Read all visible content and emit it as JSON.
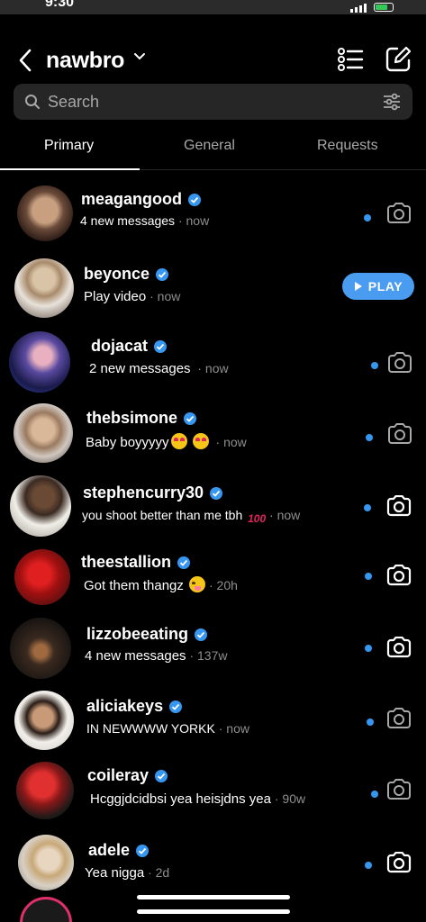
{
  "status_bar": {
    "time": "9:30"
  },
  "header": {
    "account_name": "nawbro"
  },
  "search": {
    "placeholder": "Search"
  },
  "tabs": [
    {
      "label": "Primary",
      "active": true
    },
    {
      "label": "General",
      "active": false
    },
    {
      "label": "Requests",
      "active": false
    }
  ],
  "threads": [
    {
      "username": "meagangood",
      "preview": "4 new messages",
      "time": "now",
      "unread": true,
      "action": "camera"
    },
    {
      "username": "beyonce",
      "preview": "Play video",
      "time": "now",
      "unread": false,
      "action": "play"
    },
    {
      "username": "dojacat",
      "preview": "2 new messages",
      "time": "now",
      "unread": true,
      "action": "camera"
    },
    {
      "username": "thebsimone",
      "preview": "Baby boyyyyy",
      "time": "now",
      "unread": true,
      "action": "camera"
    },
    {
      "username": "stephencurry30",
      "preview": "you shoot better than me tbh",
      "time": "now",
      "unread": true,
      "action": "camera"
    },
    {
      "username": "theestallion",
      "preview": "Got them thangz",
      "time": "20h",
      "unread": true,
      "action": "camera"
    },
    {
      "username": "lizzobeeating",
      "preview": "4 new messages",
      "time": "137w",
      "unread": true,
      "action": "camera"
    },
    {
      "username": "aliciakeys",
      "preview": "IN NEWWWW YORKK",
      "time": "now",
      "unread": true,
      "action": "camera"
    },
    {
      "username": "coileray",
      "preview": "Hcggjdcidbsi yea heisjdns yea",
      "time": "90w",
      "unread": true,
      "action": "camera"
    },
    {
      "username": "adele",
      "preview": "Yea nigga",
      "time": "2d",
      "unread": true,
      "action": "camera"
    }
  ],
  "play_button": {
    "label": "PLAY"
  },
  "colors": {
    "unread_dot": "#3797f0",
    "verified": "#3797f0",
    "play_button": "#4a9cf0",
    "search_bg": "#262626"
  },
  "icons": [
    "back-chevron-icon",
    "chevron-down-icon",
    "list-icon",
    "compose-icon",
    "search-icon",
    "filter-icon",
    "verified-badge-icon",
    "camera-icon",
    "play-icon"
  ]
}
